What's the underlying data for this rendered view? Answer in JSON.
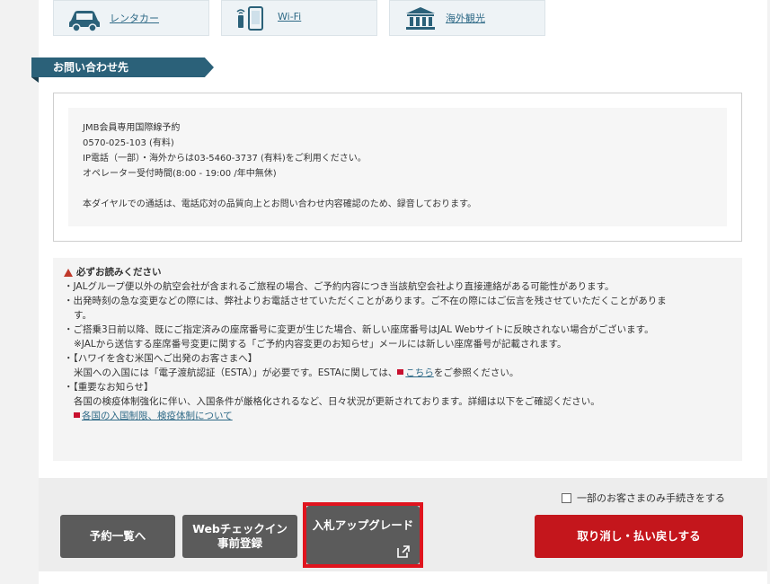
{
  "tiles": [
    {
      "label": "レンタカー",
      "icon": "car-icon"
    },
    {
      "label": "Wi-Fi",
      "icon": "wifi-device-icon"
    },
    {
      "label": "海外観光",
      "icon": "museum-icon"
    }
  ],
  "contact": {
    "section_title": "お問い合わせ先",
    "lines": [
      "JMB会員専用国際線予約",
      "0570-025-103 (有料)",
      "IP電話（一部）・海外からは03-5460-3737 (有料)をご利用ください。",
      "オペレーター受付時間(8:00 - 19:00 /年中無休)"
    ],
    "note": "本ダイヤルでの通話は、電話応対の品質向上とお問い合わせ内容確認のため、録音しております。"
  },
  "notice": {
    "title": "必ずお読みください",
    "items": [
      "・JALグループ便以外の航空会社が含まれるご旅程の場合、ご予約内容につき当該航空会社より直接連絡がある可能性があります。",
      "・出発時刻の急な変更などの際には、弊社よりお電話させていただくことがあります。ご不在の際にはご伝言を残させていただくことがありま",
      "す。",
      "・ご搭乗3日前以降、既にご指定済みの座席番号に変更が生じた場合、新しい座席番号はJAL Webサイトに反映されない場合がございます。",
      "※JALから送信する座席番号変更に関する「ご予約内容変更のお知らせ」メールには新しい座席番号が記載されます。",
      "・【ハワイを含む米国へご出発のお客さまへ】",
      "米国への入国には「電子渡航認証（ESTA）」が必要です。ESTAに関しては、",
      "こちら",
      "をご参照ください。",
      "・【重要なお知らせ】",
      "各国の検疫体制強化に伴い、入国条件が厳格化されるなど、日々状況が更新されております。詳細は以下をご確認ください。",
      "各国の入国制限、検疫体制について"
    ]
  },
  "actions": {
    "checkbox_label": "一部のお客さまのみ手続きをする",
    "reservation_list": "予約一覧へ",
    "web_checkin_line1": "Webチェックイン",
    "web_checkin_line2": "事前登録",
    "bid_upgrade": "入札アップグレード",
    "cancel_refund": "取り消し・払い戻しする"
  },
  "colors": {
    "section_tab": "#2b6179",
    "link": "#2f6a87",
    "button_gray": "#5b5b5b",
    "button_red": "#c4161c",
    "highlight": "#e0141e"
  }
}
